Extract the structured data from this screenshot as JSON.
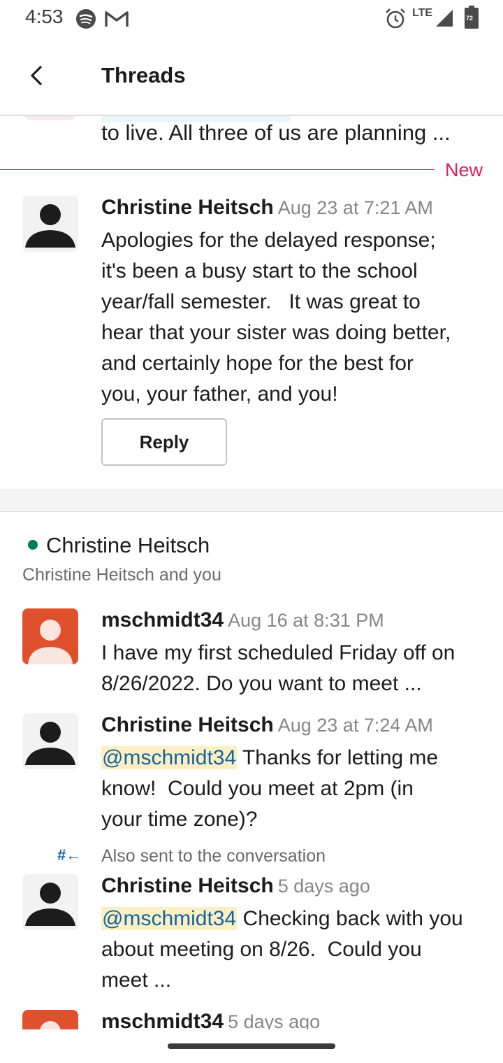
{
  "status_bar": {
    "time": "4:53",
    "network": "LTE",
    "battery": "72",
    "icons": [
      "spotify-icon",
      "gmail-icon",
      "alarm-icon",
      "signal-icon",
      "battery-icon"
    ]
  },
  "header": {
    "title": "Threads",
    "back_icon": "chevron-left-icon"
  },
  "previous_thread": {
    "snippet": "to live. All three of us are planning ..."
  },
  "new_divider": {
    "label": "New"
  },
  "thread1_reply": {
    "author": "Christine Heitsch",
    "timestamp": "Aug 23 at 7:21 AM",
    "lines": [
      "Apologies for the delayed response;",
      "it's been a busy start to the school",
      "year/fall semester.   It was great to",
      "hear that your sister was doing better,",
      "and certainly hope for the best for",
      "you, your father, and you!"
    ],
    "reply_label": "Reply"
  },
  "thread2": {
    "title": "Christine Heitsch",
    "subtitle": "Christine Heitsch and you",
    "messages": [
      {
        "author": "mschmidt34",
        "timestamp": "Aug 16 at 8:31 PM",
        "lines": [
          "I have my first scheduled Friday off on",
          "8/26/2022. Do you want to meet ..."
        ]
      },
      {
        "author": "Christine Heitsch",
        "timestamp": "Aug 23 at 7:24 AM",
        "mention": "@mschmidt34",
        "line1_rest": " Thanks for letting me",
        "lines": [
          "know!  Could you meet at 2pm (in",
          "your time zone)?"
        ]
      },
      {
        "also_sent": "Also sent to the conversation",
        "also_sent_icon": "#←",
        "author": "Christine Heitsch",
        "timestamp": "5 days ago",
        "mention": "@mschmidt34",
        "line1_rest": " Checking back with you",
        "lines": [
          "about meeting on 8/26.  Could you",
          "meet ..."
        ]
      },
      {
        "author": "mschmidt34",
        "timestamp": "5 days ago"
      }
    ]
  },
  "colors": {
    "accent_new": "#e01e5a",
    "presence_green": "#007a5a",
    "mention_bg": "#fcefc4",
    "mention_text": "#1264a3",
    "avatar_red": "#e0502c"
  }
}
